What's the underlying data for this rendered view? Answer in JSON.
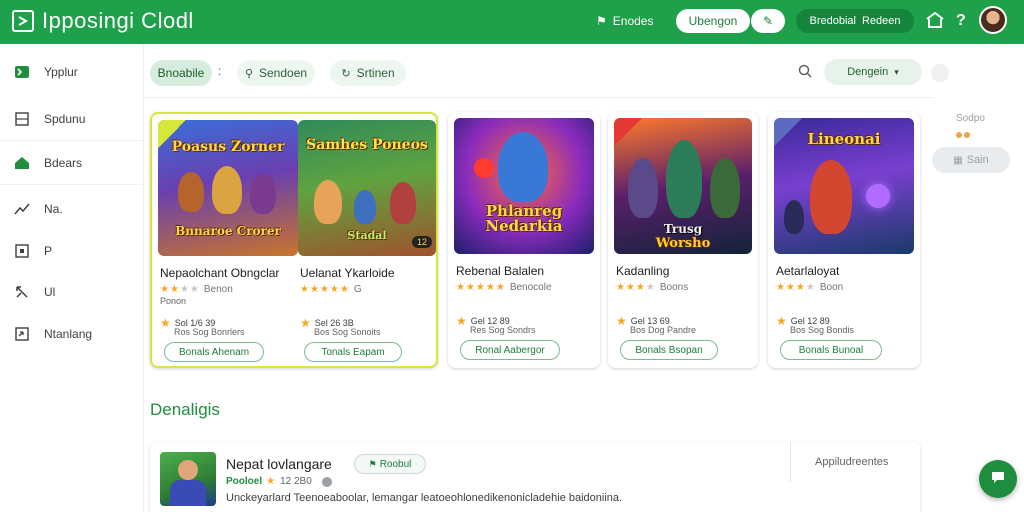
{
  "app": {
    "title": "Ipposingi Clodl"
  },
  "header": {
    "link_label": "Enodes",
    "pill_primary": "Ubengon",
    "pill_secondary_icon": "edit-icon",
    "pill_dark_left": "Bredobial",
    "pill_dark_right": "Redeen",
    "icons": [
      "store-icon",
      "help-icon",
      "avatar"
    ]
  },
  "sidebar": {
    "items": [
      {
        "label": "Ypplur",
        "icon": "apps-icon",
        "active": true
      },
      {
        "label": "Spdunu",
        "icon": "square-icon",
        "active": false
      },
      {
        "label": "Bdears",
        "icon": "home-icon",
        "active": true
      },
      {
        "label": "Na.",
        "icon": "trend-icon",
        "active": false
      },
      {
        "label": "P",
        "icon": "box-icon",
        "active": false
      },
      {
        "label": "Ul",
        "icon": "tools-icon",
        "active": false
      },
      {
        "label": "Ntanlang",
        "icon": "shield-icon",
        "active": false
      }
    ]
  },
  "filters": {
    "chip_1": "Bnoabile",
    "separator": ":",
    "chip_2": "Sendoen",
    "chip_3": "Srtinen"
  },
  "right": {
    "dropdown_label": "Dengein",
    "panel_label": "Sodpo",
    "panel_button": "Sain"
  },
  "cards": [
    {
      "art_title": "Poasus Zorner",
      "art_subtitle": "Bnnaroe Crorer",
      "title": "Nepaolchant Obngclar",
      "sub": "Ponon",
      "rating_note": "Benon",
      "meta_line": "Sol 1/6 39",
      "meta_sub": "Ros Sog Bonrlers",
      "button": "Bonals Ahenam"
    },
    {
      "art_title": "Samhes Poneos",
      "art_subtitle": "Stadal",
      "badge": "12",
      "title": "Uelanat Ykarloide",
      "rating_note": "G",
      "meta_line": "Sel 26 3B",
      "meta_sub": "Bos Sog Sonoits",
      "button": "Tonals Eapam"
    },
    {
      "art_title": "Phlanreg Nedarkia",
      "title": "Rebenal Balalen",
      "rating_note": "Benocole",
      "meta_line": "Gel 12 89",
      "meta_sub": "Res Sog Sondrs",
      "button": "Ronal Aabergor"
    },
    {
      "art_title": "Worsho",
      "art_subtitle": "Trusg",
      "title": "Kadanling",
      "rating_note": "Boons",
      "meta_line": "Gel 13 69",
      "meta_sub": "Bos Dog Pandre",
      "button": "Bonals Bsopan"
    },
    {
      "art_title": "Lineonai",
      "title": "Aetarlaloyat",
      "rating_note": "Boon",
      "meta_line": "Gel 12 89",
      "meta_sub": "Bos Sog Bondis",
      "button": "Bonals Bunoal"
    }
  ],
  "section": {
    "title": "Denaligis"
  },
  "list_item": {
    "title": "Nepat lovlangare",
    "tag": "Roobul",
    "release_label": "Pooloel",
    "rating_text": "12 2B0",
    "description": "Unckeyarlard Teenoeaboolar, lemangar leatoeohlonedikenonicladehie baidoniina.",
    "right_label": "Appiludreentes"
  },
  "colors": {
    "brand": "#1fa04a",
    "accent": "#1e8e3e",
    "star": "#f5a623",
    "featured_border": "#d7e63a"
  }
}
